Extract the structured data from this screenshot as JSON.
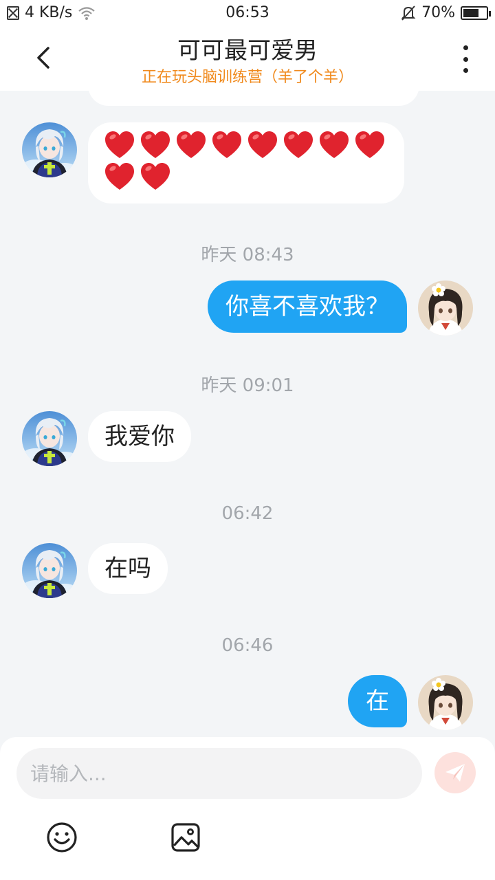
{
  "status_bar": {
    "network_speed": "4 KB/s",
    "time": "06:53",
    "battery_percent": "70%",
    "battery_level": 0.7
  },
  "header": {
    "title": "可可最可爱男",
    "subtitle": "正在玩头脑训练营（羊了个羊）"
  },
  "messages": [
    {
      "type": "incoming",
      "content": "❤️❤️❤️❤️❤️❤️❤️❤️❤️❤️",
      "heart_count": 10
    },
    {
      "type": "timestamp",
      "text": "昨天 08:43"
    },
    {
      "type": "outgoing",
      "text": "你喜不喜欢我？"
    },
    {
      "type": "timestamp",
      "text": "昨天 09:01"
    },
    {
      "type": "incoming",
      "text": "我爱你"
    },
    {
      "type": "timestamp",
      "text": "06:42"
    },
    {
      "type": "incoming",
      "text": "在吗"
    },
    {
      "type": "timestamp",
      "text": "06:46"
    },
    {
      "type": "outgoing",
      "text": "在"
    }
  ],
  "input": {
    "placeholder": "请输入..."
  },
  "colors": {
    "outgoing_bubble": "#20a4f3",
    "subtitle": "#f08a1d",
    "background": "#f3f5f7",
    "send_button": "#fde1dd"
  },
  "icons": {
    "back": "chevron-left-icon",
    "more": "more-vertical-icon",
    "send": "paper-plane-icon",
    "emoji": "smiley-icon",
    "image": "image-icon"
  }
}
